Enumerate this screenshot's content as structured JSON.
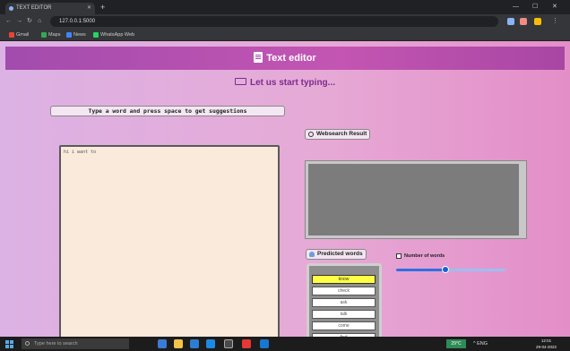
{
  "browser": {
    "tab_title": "TEXT EDITOR",
    "new_tab_icon": "plus-icon",
    "url": "127.0.0.1:5000",
    "bookmarks": [
      {
        "label": "Gmail",
        "color": "#ea4335"
      },
      {
        "label": "Maps",
        "color": "#34a853"
      },
      {
        "label": "News",
        "color": "#4285f4"
      },
      {
        "label": "WhatsApp Web",
        "color": "#25d366"
      }
    ]
  },
  "app": {
    "title": "Text editor",
    "subtitle": "Let us start typing...",
    "prompt": "Type a word and press space to get suggestions",
    "editor_text": "hi i want to",
    "web_label": "Websearch Result",
    "predicted_label": "Predicted words",
    "num_words_label": "Number of words",
    "slider_fraction": 0.45,
    "predicted_words": [
      "know",
      "check",
      "ask",
      "talk",
      "come",
      "find",
      ""
    ],
    "selected_index": 0,
    "colors": {
      "header": "#a24cae",
      "selected": "#ffff44",
      "accent": "#7c2c8c"
    }
  },
  "taskbar": {
    "search_placeholder": "Type here to search",
    "weather": "29°C",
    "time": "12:01",
    "date": "29-04-2022",
    "tray": "^ ENG"
  }
}
